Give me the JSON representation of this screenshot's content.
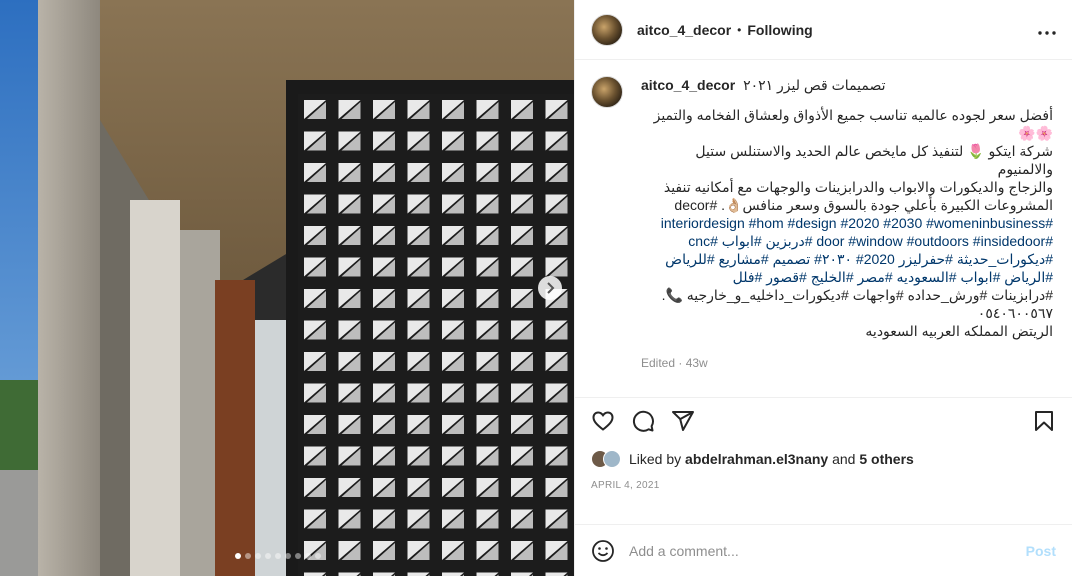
{
  "header": {
    "username": "aitco_4_decor",
    "separator": "•",
    "follow_status": "Following",
    "more_icon": "more-horizontal-icon"
  },
  "caption": {
    "username": "aitco_4_decor",
    "title": "تصميمات قص ليزر ٢٠٢١",
    "line1": "أفضل سعر لجوده عالميه تناسب جميع الأذواق ولعشاق الفخامه والتميز",
    "line2": "🌸🌸",
    "line3": "شركة ايتكو 🌷 لتنفيذ كل مايخص عالم الحديد والاستنلس ستيل والالمنيوم",
    "line4": "والزجاج والديكورات والابواب والدرابزينات والوجهات مع أمكانيه تنفيذ",
    "line5": "المشروعات الكبيرة بأعلي جودة بالسوق وسعر منافس👌🏼. #decor",
    "line6": "#interiordesign #hom #design #2020 #2030 #womeninbusiness",
    "line7": "#door #window #outdoors #insidedoor #دربزين #ابواب #cnc",
    "line8": "#ديكورات_حديثة #حفرليزر 2020# ٢٠٣٠# تصميم #مشاريع #للرياض",
    "line9": "#الرياض #ابواب #السعوديه #مصر #الخليج #قصور #فلل",
    "line10": "#درابزينات #ورش_حداده #واجهات #ديكورات_داخليه_و_خارجيه 📞.",
    "line11": "٠٥٤٠٦٠٠٥٦٧",
    "line12": "الريتض المملكه العربيه السعوديه",
    "edited": "Edited · 43w"
  },
  "actions": {
    "like_icon": "heart-icon",
    "comment_icon": "comment-icon",
    "share_icon": "share-icon",
    "save_icon": "bookmark-icon"
  },
  "likes": {
    "prefix": "Liked by ",
    "user": "abdelrahman.el3nany",
    "middle": " and ",
    "others": "5 others"
  },
  "date": "APRIL 4, 2021",
  "comment": {
    "placeholder": "Add a comment...",
    "post_label": "Post",
    "emoji_icon": "emoji-icon"
  },
  "carousel": {
    "total": 9,
    "active": 1,
    "next_icon": "chevron-right-icon"
  },
  "colors": {
    "link": "#00376b",
    "muted": "#8e8e8e",
    "post_disabled": "#b2dffc"
  }
}
